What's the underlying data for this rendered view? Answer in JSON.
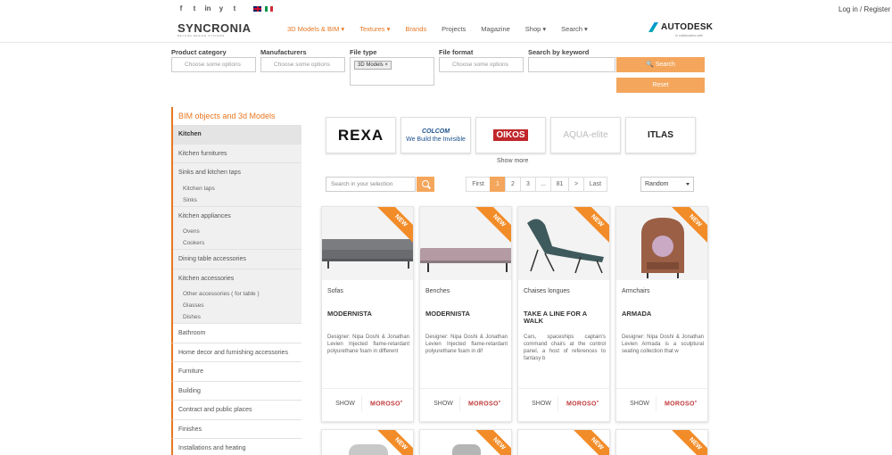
{
  "topbar": {
    "social": [
      "f",
      "t",
      "in",
      "y",
      "t"
    ],
    "login": "Log in / Register"
  },
  "header": {
    "logo_main": "SYNCRONIA",
    "logo_sub": "BEYOND DESIGN SYSTEMS",
    "nav": [
      {
        "label": "3D Models & BIM ▾",
        "accent": true
      },
      {
        "label": "Textures ▾",
        "accent": true
      },
      {
        "label": "Brands",
        "accent": true
      },
      {
        "label": "Projects",
        "accent": false
      },
      {
        "label": "Magazine",
        "accent": false
      },
      {
        "label": "Shop ▾",
        "accent": false
      },
      {
        "label": "Search ▾",
        "accent": false
      }
    ],
    "partner": "AUTODESK",
    "partner_sub": "In collaboration with"
  },
  "filters": {
    "category_label": "Product category",
    "category_placeholder": "Choose some options",
    "manufacturers_label": "Manufacturers",
    "manufacturers_placeholder": "Choose some options",
    "filetype_label": "File type",
    "filetype_tag": "3D Models ×",
    "fileformat_label": "File format",
    "fileformat_placeholder": "Choose some options",
    "keyword_label": "Search by keyword",
    "keyword_value": "",
    "search_button": "🔍 Search",
    "reset_button": "Reset"
  },
  "sidebar": {
    "title": "BIM objects and 3d Models",
    "kitchen": "Kitchen",
    "kitchen_furnitures": "Kitchen furnitures",
    "sinks_taps": "Sinks and kitchen taps",
    "kitchen_taps": "Kitchen taps",
    "sinks": "Sinks",
    "appliances": "Kitchen appliances",
    "ovens": "Ovens",
    "cookers": "Cookers",
    "dining": "Dining table accessories",
    "accessories": "Kitchen accessories",
    "other_acc": "Other accessories ( for table )",
    "glasses": "Glasses",
    "dishes": "Dishes",
    "bathroom": "Bathroom",
    "home_decor": "Home decor and furnishing accessories",
    "furniture": "Furniture",
    "building": "Building",
    "contract": "Contract and public places",
    "finishes": "Finishes",
    "installations": "Installations and heating"
  },
  "brands": {
    "rexa": "REXA",
    "colcom": "COLCOM",
    "colcom_sub": "We Build the Invisible",
    "oikos": "OIKOS",
    "aqua": "AQUA-elite",
    "itlas": "ITLAS",
    "show_more": "Show more"
  },
  "toolbar": {
    "selection_placeholder": "Search in your selection",
    "pages": [
      "First",
      "1",
      "2",
      "3",
      "...",
      "81",
      ">",
      "Last"
    ],
    "active_page": "1",
    "sort": "Random"
  },
  "products": [
    {
      "category": "Sofas",
      "name": "MODERNISTA",
      "desc": "Designer: Nipa Doshi & Jonathan Levien Injected flame-retardant polyurethane foam in different",
      "badge": "NEW",
      "show": "SHOW",
      "brand": "MOROSO"
    },
    {
      "category": "Benches",
      "name": "MODERNISTA",
      "desc": "Designer: Nipa Doshi & Jonathan Levien Injected flame-retardant polyurethane foam in dif",
      "badge": "NEW",
      "show": "SHOW",
      "brand": "MOROSO"
    },
    {
      "category": "Chaises longues",
      "name": "TAKE A LINE FOR A WALK",
      "desc": "Cars, spaceships captain's command chairs at the control panel, a host of references to fantasy b",
      "badge": "NEW",
      "show": "SHOW",
      "brand": "MOROSO"
    },
    {
      "category": "Armchairs",
      "name": "ARMADA",
      "desc": "Designer: Nipa Doshi & Jonathan Levien Armada is a sculptural seating collection that w",
      "badge": "NEW",
      "show": "SHOW",
      "brand": "MOROSO"
    }
  ],
  "colors": {
    "accent": "#e87722",
    "button": "#f4a65c",
    "ribbon": "#f28c28",
    "moroso": "#c0393b"
  }
}
